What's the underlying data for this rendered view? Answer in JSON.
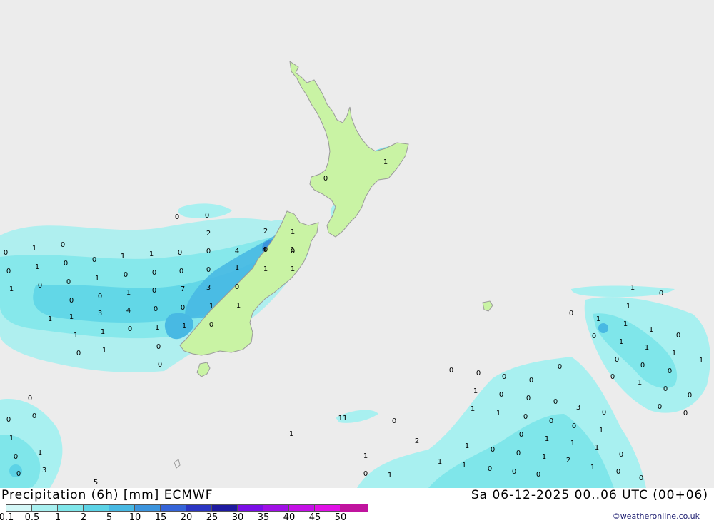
{
  "title": "Precipitation (6h) [mm] ECMWF",
  "timestamp": "Sa 06-12-2025 00..06 UTC (00+06)",
  "credit": "©weatheronline.co.uk",
  "legend": {
    "ticks": [
      "0.1",
      "0.5",
      "1",
      "2",
      "5",
      "10",
      "15",
      "20",
      "25",
      "30",
      "35",
      "40",
      "45",
      "50"
    ],
    "colors": [
      "#d4f7f7",
      "#a8f0f0",
      "#7fe6ea",
      "#5cd3e6",
      "#48b9e3",
      "#3c94dd",
      "#3564d8",
      "#2b35c2",
      "#1e1aa0",
      "#7a0ee6",
      "#a010e6",
      "#c410e6",
      "#e010e6",
      "#c0149e"
    ]
  },
  "colors": {
    "sea": "#ececec",
    "land": "#c9f3a4",
    "coast": "#9a9a9a"
  },
  "values": [
    "0",
    "1",
    "0",
    "0",
    "1",
    "0",
    "0",
    "1",
    "1",
    "0",
    "0",
    "1",
    "0",
    "0",
    "1",
    "0",
    "0",
    "0",
    "0",
    "1",
    "0",
    "1",
    "2",
    "4",
    "1",
    "1",
    "0",
    "0",
    "1",
    "0",
    "7",
    "3",
    "0",
    "2",
    "1",
    "1",
    "1",
    "3",
    "4",
    "0",
    "0",
    "1",
    "1",
    "1",
    "1",
    "0",
    "1",
    "1",
    "0",
    "0",
    "1",
    "0",
    "0",
    "0",
    "0",
    "0",
    "0",
    "0",
    "1",
    "1",
    "0",
    "0",
    "3",
    "5",
    "1",
    "0",
    "4",
    "0",
    "11",
    "1",
    "0",
    "2",
    "1",
    "0",
    "1",
    "0",
    "1",
    "1",
    "1",
    "0",
    "0",
    "1",
    "1",
    "1",
    "1",
    "0",
    "0",
    "0",
    "0",
    "1",
    "0",
    "0",
    "0",
    "0",
    "0",
    "0",
    "0",
    "0",
    "0",
    "1",
    "0",
    "0",
    "0",
    "1",
    "1",
    "0",
    "0",
    "3",
    "0",
    "0",
    "1",
    "0",
    "1",
    "1",
    "1",
    "1",
    "0",
    "0",
    "1",
    "2",
    "1",
    "1",
    "0",
    "0",
    "0",
    "0",
    "1",
    "0",
    "0",
    "1",
    "0",
    "1"
  ]
}
